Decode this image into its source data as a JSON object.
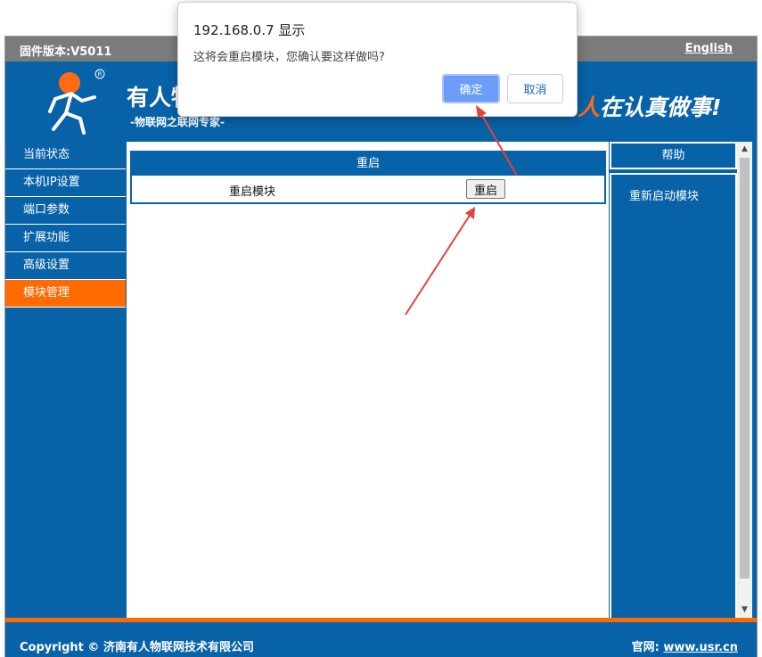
{
  "topbar": {
    "firmware": "固件版本:V5011",
    "language": "English"
  },
  "banner": {
    "brand_name": "有人物",
    "brand_sub": "-物联网之联网专家-",
    "slogan_highlight": "人",
    "slogan_rest": "在认真做事!",
    "logo_registered": "R"
  },
  "sidebar": {
    "items": [
      {
        "label": "当前状态"
      },
      {
        "label": "本机IP设置"
      },
      {
        "label": "端口参数"
      },
      {
        "label": "扩展功能"
      },
      {
        "label": "高级设置"
      },
      {
        "label": "模块管理",
        "active": true
      }
    ]
  },
  "main": {
    "panel_title": "重启",
    "row_label": "重启模块",
    "button_label": "重启"
  },
  "help": {
    "title": "帮助",
    "text": "重新启动模块"
  },
  "footer": {
    "copyright": "Copyright © 济南有人物联网技术有限公司",
    "site_label": "官网:",
    "site_link": "www.usr.cn"
  },
  "dialog": {
    "title": "192.168.0.7 显示",
    "message": "这将会重启模块，您确认要这样做吗?",
    "ok_label": "确定",
    "cancel_label": "取消"
  },
  "colors": {
    "brand_blue": "#0862a8",
    "accent_orange": "#ff6b00",
    "annotation_red": "#e8403a",
    "dialog_ok": "#6c9ef8"
  }
}
